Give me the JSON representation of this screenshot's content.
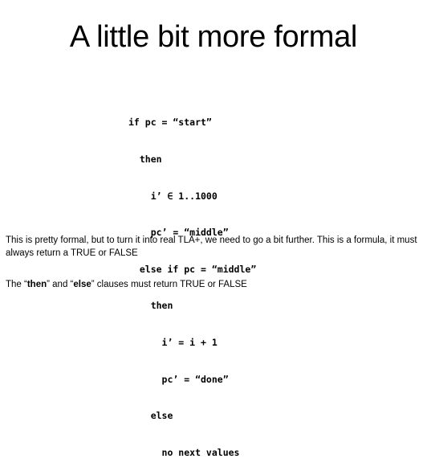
{
  "slide": {
    "title": "A little bit more formal"
  },
  "code": {
    "lines": [
      "if pc = “start”",
      "  then",
      "    i’ ∈ 1..1000",
      "    pc’ = “middle”",
      "  else if pc = “middle”",
      "    then",
      "      i’ = i + 1",
      "      pc’ = “done”",
      "    else",
      "      no next values"
    ]
  },
  "paragraphs": {
    "first": "This is pretty formal, but to turn it into real TLA+, we need to go a bit further. This is a formula, it must always return a TRUE or FALSE",
    "second": {
      "part1": "The “",
      "then_kw": "then",
      "part2": "” and “",
      "else_kw": "else",
      "part3": "” clauses must return TRUE or FALSE"
    }
  }
}
